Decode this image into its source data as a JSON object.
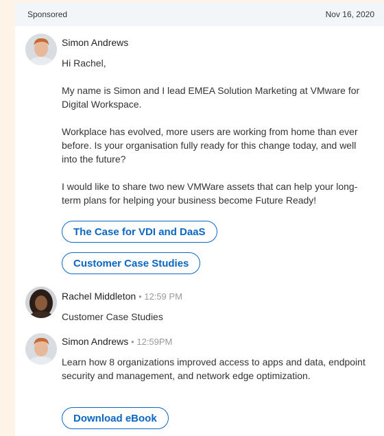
{
  "header": {
    "sponsored": "Sponsored",
    "date": "Nov 16, 2020"
  },
  "messages": [
    {
      "sender": "Simon Andrews",
      "time": "",
      "greeting": "Hi Rachel,",
      "paragraphs": [
        "My name is Simon and I lead EMEA Solution Marketing at VMware for Digital Workspace.",
        "Workplace has evolved, more users are working from home than ever before. Is your organisation fully ready for this change today, and well into the future?",
        "I would like to share two new VMWare assets that can help your long-term plans for helping your business become Future Ready!"
      ],
      "buttons": [
        "The Case for VDI and DaaS",
        "Customer Case Studies"
      ]
    },
    {
      "sender": "Rachel Middleton",
      "time": "12:59 PM",
      "text": "Customer Case Studies"
    },
    {
      "sender": "Simon Andrews",
      "time": "12:59PM",
      "text": "Learn how 8 organizations improved access to apps and data, endpoint security and management, and network edge optimization.",
      "buttons": [
        "Download eBook"
      ]
    }
  ],
  "colors": {
    "accent": "#0a66c2",
    "page_bg": "#fdf3e7",
    "header_bg": "#f3f6f8"
  },
  "separator": "•"
}
